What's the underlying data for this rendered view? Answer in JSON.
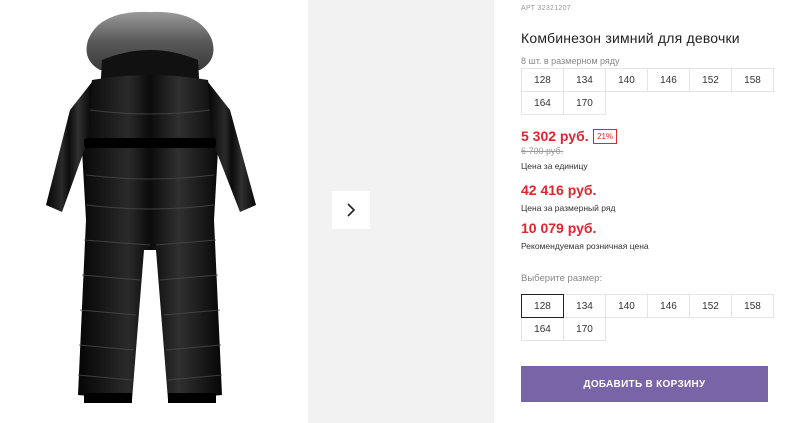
{
  "product": {
    "sku": "АРТ 32321207",
    "title": "Комбинезон зимний для девочки",
    "image_alt": "black winter jumpsuit with fur hood"
  },
  "gallery": {
    "next_icon": "chevron-right-icon"
  },
  "pack": {
    "note": "8 шт. в размерном ряду",
    "sizes": [
      "128",
      "134",
      "140",
      "146",
      "152",
      "158",
      "164",
      "170"
    ]
  },
  "pricing": {
    "unit_price": "5 302 руб.",
    "discount": "21%",
    "old_price": "6 700 руб.",
    "unit_caption": "Цена за единицу",
    "pack_price": "42 416 руб.",
    "pack_caption": "Цена за размерный ряд",
    "retail_price": "10 079 руб.",
    "retail_caption": "Рекомендуемая розничная цена",
    "accent_color": "#e0252d"
  },
  "size_select": {
    "label": "Выберите размер:",
    "selected": "128",
    "sizes": [
      "128",
      "134",
      "140",
      "146",
      "152",
      "158",
      "164",
      "170"
    ]
  },
  "cart": {
    "button_label": "ДОБАВИТЬ В КОРЗИНУ",
    "button_color": "#7a64a8"
  }
}
